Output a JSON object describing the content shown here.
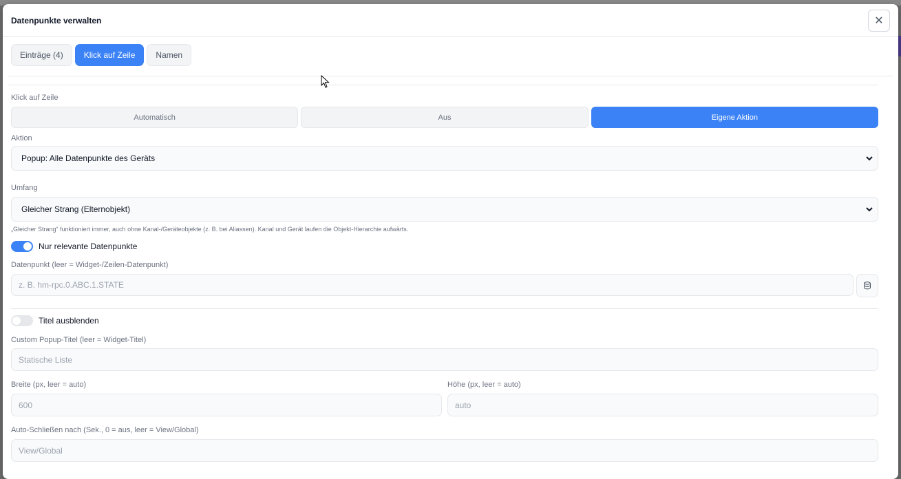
{
  "dialog": {
    "title": "Datenpunkte verwalten",
    "close_glyph": "✕"
  },
  "tabs": [
    {
      "label": "Einträge (4)",
      "active": false
    },
    {
      "label": "Klick auf Zeile",
      "active": true
    },
    {
      "label": "Namen",
      "active": false
    }
  ],
  "click_row": {
    "label": "Klick auf Zeile",
    "options": [
      {
        "label": "Automatisch",
        "active": false
      },
      {
        "label": "Aus",
        "active": false
      },
      {
        "label": "Eigene Aktion",
        "active": true
      }
    ]
  },
  "action": {
    "label": "Aktion",
    "value": "Popup: Alle Datenpunkte des Geräts"
  },
  "scope": {
    "label": "Umfang",
    "value": "Gleicher Strang (Elternobjekt)",
    "hint": "„Gleicher Strang“ funktioniert immer, auch ohne Kanal-/Geräteobjekte (z. B. bei Aliassen). Kanal und Gerät laufen die Objekt-Hierarchie aufwärts."
  },
  "relevant_only": {
    "label": "Nur relevante Datenpunkte",
    "on": true
  },
  "datapoint": {
    "label": "Datenpunkt (leer = Widget-/Zeilen-Datenpunkt)",
    "placeholder": "z. B. hm-rpc.0.ABC.1.STATE",
    "icon": "database-icon"
  },
  "hide_title": {
    "label": "Titel ausblenden",
    "on": false
  },
  "popup_title": {
    "label": "Custom Popup-Titel (leer = Widget-Titel)",
    "placeholder": "Statische Liste"
  },
  "width": {
    "label": "Breite (px, leer = auto)",
    "placeholder": "600"
  },
  "height": {
    "label": "Höhe (px, leer = auto)",
    "placeholder": "auto"
  },
  "auto_close": {
    "label": "Auto-Schließen nach (Sek., 0 = aus, leer = View/Global)",
    "placeholder": "View/Global"
  },
  "colors": {
    "accent": "#3b82f6",
    "backdrop": "#6b6b6b"
  }
}
